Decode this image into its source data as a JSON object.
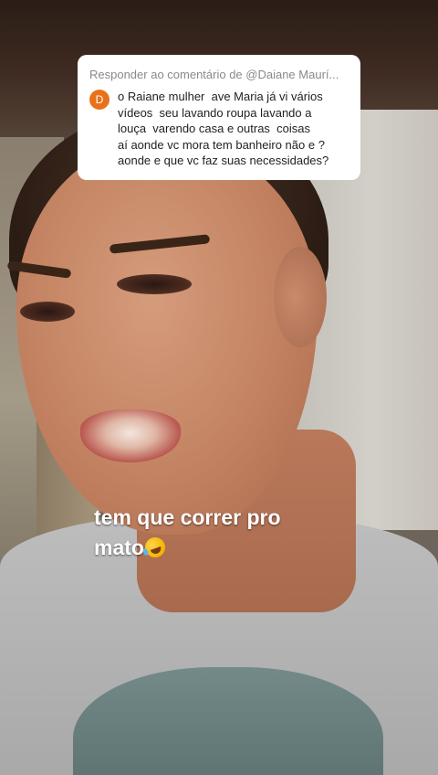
{
  "reply": {
    "header": "Responder ao comentário de @Daiane Maurí...",
    "avatar_letter": "D",
    "avatar_color": "#e8721c",
    "comment": "o Raiane mulher  ave Maria já vi vários\nvídeos  seu lavando roupa lavando a\nlouça  varendo casa e outras  coisas\naí aonde vc mora tem banheiro não e ?\naonde e que vc faz suas necessidades?"
  },
  "caption": {
    "text": "tem que correr pro\nmato",
    "emoji": "rolling-on-floor-laughing"
  }
}
